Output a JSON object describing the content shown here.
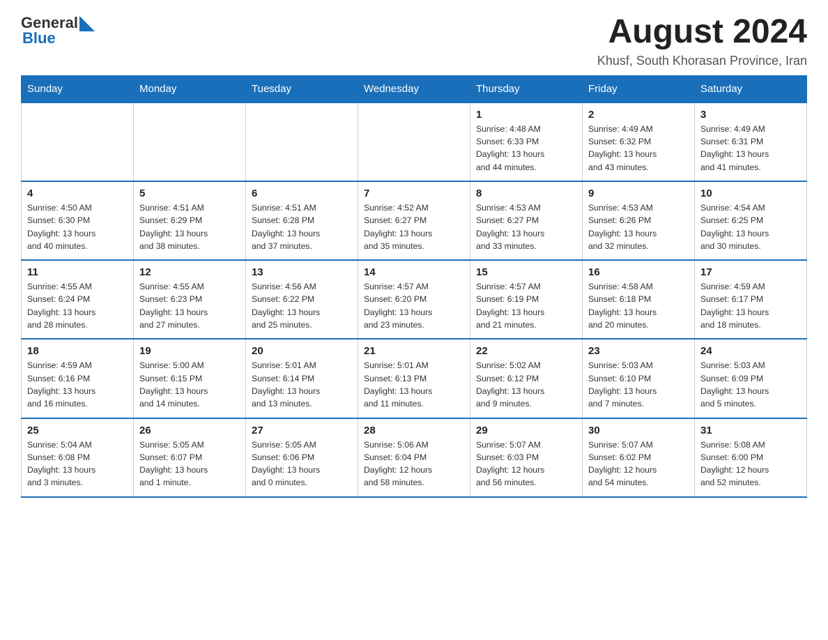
{
  "header": {
    "logo_general": "General",
    "logo_blue": "Blue",
    "month_year": "August 2024",
    "location": "Khusf, South Khorasan Province, Iran"
  },
  "days_of_week": [
    "Sunday",
    "Monday",
    "Tuesday",
    "Wednesday",
    "Thursday",
    "Friday",
    "Saturday"
  ],
  "weeks": [
    [
      {
        "day": "",
        "info": ""
      },
      {
        "day": "",
        "info": ""
      },
      {
        "day": "",
        "info": ""
      },
      {
        "day": "",
        "info": ""
      },
      {
        "day": "1",
        "info": "Sunrise: 4:48 AM\nSunset: 6:33 PM\nDaylight: 13 hours\nand 44 minutes."
      },
      {
        "day": "2",
        "info": "Sunrise: 4:49 AM\nSunset: 6:32 PM\nDaylight: 13 hours\nand 43 minutes."
      },
      {
        "day": "3",
        "info": "Sunrise: 4:49 AM\nSunset: 6:31 PM\nDaylight: 13 hours\nand 41 minutes."
      }
    ],
    [
      {
        "day": "4",
        "info": "Sunrise: 4:50 AM\nSunset: 6:30 PM\nDaylight: 13 hours\nand 40 minutes."
      },
      {
        "day": "5",
        "info": "Sunrise: 4:51 AM\nSunset: 6:29 PM\nDaylight: 13 hours\nand 38 minutes."
      },
      {
        "day": "6",
        "info": "Sunrise: 4:51 AM\nSunset: 6:28 PM\nDaylight: 13 hours\nand 37 minutes."
      },
      {
        "day": "7",
        "info": "Sunrise: 4:52 AM\nSunset: 6:27 PM\nDaylight: 13 hours\nand 35 minutes."
      },
      {
        "day": "8",
        "info": "Sunrise: 4:53 AM\nSunset: 6:27 PM\nDaylight: 13 hours\nand 33 minutes."
      },
      {
        "day": "9",
        "info": "Sunrise: 4:53 AM\nSunset: 6:26 PM\nDaylight: 13 hours\nand 32 minutes."
      },
      {
        "day": "10",
        "info": "Sunrise: 4:54 AM\nSunset: 6:25 PM\nDaylight: 13 hours\nand 30 minutes."
      }
    ],
    [
      {
        "day": "11",
        "info": "Sunrise: 4:55 AM\nSunset: 6:24 PM\nDaylight: 13 hours\nand 28 minutes."
      },
      {
        "day": "12",
        "info": "Sunrise: 4:55 AM\nSunset: 6:23 PM\nDaylight: 13 hours\nand 27 minutes."
      },
      {
        "day": "13",
        "info": "Sunrise: 4:56 AM\nSunset: 6:22 PM\nDaylight: 13 hours\nand 25 minutes."
      },
      {
        "day": "14",
        "info": "Sunrise: 4:57 AM\nSunset: 6:20 PM\nDaylight: 13 hours\nand 23 minutes."
      },
      {
        "day": "15",
        "info": "Sunrise: 4:57 AM\nSunset: 6:19 PM\nDaylight: 13 hours\nand 21 minutes."
      },
      {
        "day": "16",
        "info": "Sunrise: 4:58 AM\nSunset: 6:18 PM\nDaylight: 13 hours\nand 20 minutes."
      },
      {
        "day": "17",
        "info": "Sunrise: 4:59 AM\nSunset: 6:17 PM\nDaylight: 13 hours\nand 18 minutes."
      }
    ],
    [
      {
        "day": "18",
        "info": "Sunrise: 4:59 AM\nSunset: 6:16 PM\nDaylight: 13 hours\nand 16 minutes."
      },
      {
        "day": "19",
        "info": "Sunrise: 5:00 AM\nSunset: 6:15 PM\nDaylight: 13 hours\nand 14 minutes."
      },
      {
        "day": "20",
        "info": "Sunrise: 5:01 AM\nSunset: 6:14 PM\nDaylight: 13 hours\nand 13 minutes."
      },
      {
        "day": "21",
        "info": "Sunrise: 5:01 AM\nSunset: 6:13 PM\nDaylight: 13 hours\nand 11 minutes."
      },
      {
        "day": "22",
        "info": "Sunrise: 5:02 AM\nSunset: 6:12 PM\nDaylight: 13 hours\nand 9 minutes."
      },
      {
        "day": "23",
        "info": "Sunrise: 5:03 AM\nSunset: 6:10 PM\nDaylight: 13 hours\nand 7 minutes."
      },
      {
        "day": "24",
        "info": "Sunrise: 5:03 AM\nSunset: 6:09 PM\nDaylight: 13 hours\nand 5 minutes."
      }
    ],
    [
      {
        "day": "25",
        "info": "Sunrise: 5:04 AM\nSunset: 6:08 PM\nDaylight: 13 hours\nand 3 minutes."
      },
      {
        "day": "26",
        "info": "Sunrise: 5:05 AM\nSunset: 6:07 PM\nDaylight: 13 hours\nand 1 minute."
      },
      {
        "day": "27",
        "info": "Sunrise: 5:05 AM\nSunset: 6:06 PM\nDaylight: 13 hours\nand 0 minutes."
      },
      {
        "day": "28",
        "info": "Sunrise: 5:06 AM\nSunset: 6:04 PM\nDaylight: 12 hours\nand 58 minutes."
      },
      {
        "day": "29",
        "info": "Sunrise: 5:07 AM\nSunset: 6:03 PM\nDaylight: 12 hours\nand 56 minutes."
      },
      {
        "day": "30",
        "info": "Sunrise: 5:07 AM\nSunset: 6:02 PM\nDaylight: 12 hours\nand 54 minutes."
      },
      {
        "day": "31",
        "info": "Sunrise: 5:08 AM\nSunset: 6:00 PM\nDaylight: 12 hours\nand 52 minutes."
      }
    ]
  ]
}
